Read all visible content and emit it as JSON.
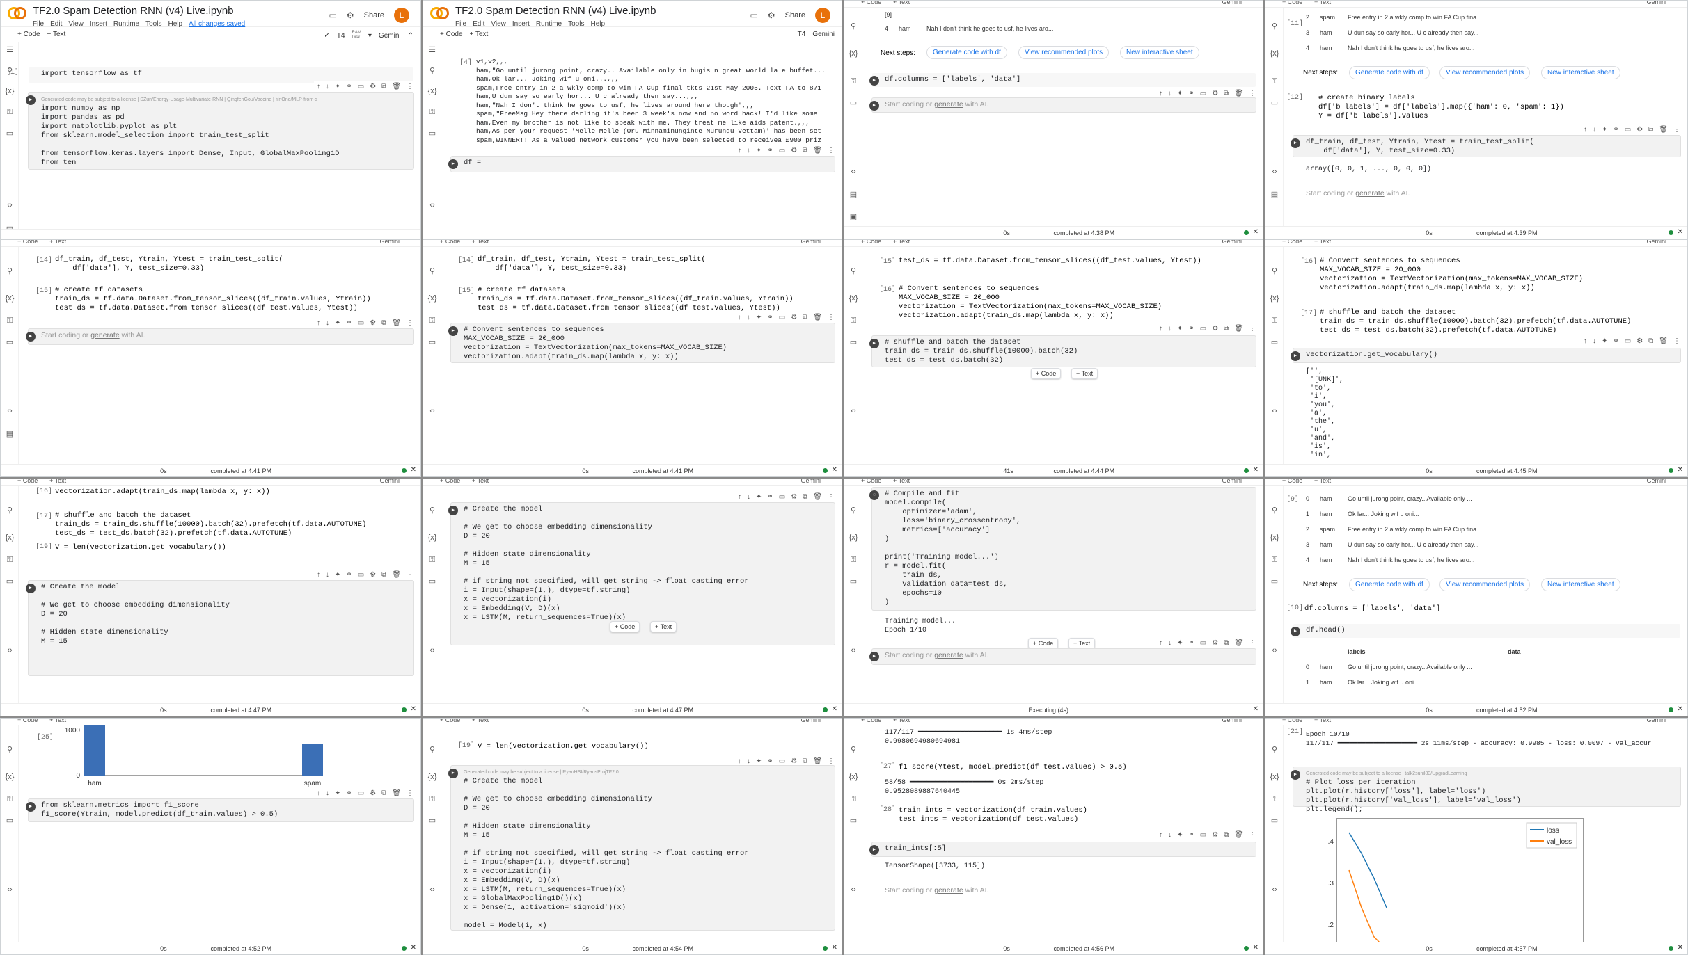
{
  "notebook": {
    "title": "TF2.0 Spam Detection RNN (v4) Live.ipynb",
    "menu": [
      "File",
      "Edit",
      "View",
      "Insert",
      "Runtime",
      "Tools",
      "Help"
    ],
    "saved": "All changes saved",
    "share": "Share",
    "avatar": "L",
    "add_code": "+ Code",
    "add_text": "+ Text",
    "runtime": "T4",
    "ram": "RAM",
    "disk": "Disk",
    "gemini": "Gemini",
    "placeholder_a": "Start coding or ",
    "placeholder_link": "generate",
    "placeholder_b": " with AI.",
    "generated_notice": "Generated code may be subject to a license | SZun/Energy-Usage-Multivariate-RNN | QingfenGou/Vaccine | YnOne/MLP-from-s",
    "notice2": "Generated code may be subject to a license | RyanHSI/RyansProjTF2.0",
    "notice3": "Generated code may be subject to a license | talk2sunil83/UpgradLearning",
    "next_steps": "Next steps:",
    "btn_gen": "Generate code with df",
    "btn_plots": "View recommended plots",
    "btn_sheet": "New interactive sheet"
  },
  "panels": [
    {
      "status_time": "",
      "status_text": ""
    },
    {
      "status_time": "",
      "status_text": ""
    },
    {
      "status_time": "0s",
      "status_text": "completed at 4:38 PM"
    },
    {
      "status_time": "0s",
      "status_text": "completed at 4:39 PM"
    },
    {
      "status_time": "0s",
      "status_text": "completed at 4:41 PM"
    },
    {
      "status_time": "0s",
      "status_text": "completed at 4:41 PM"
    },
    {
      "status_time": "41s",
      "status_text": "completed at 4:44 PM"
    },
    {
      "status_time": "0s",
      "status_text": "completed at 4:45 PM"
    },
    {
      "status_time": "0s",
      "status_text": "completed at 4:47 PM"
    },
    {
      "status_time": "0s",
      "status_text": "completed at 4:47 PM"
    },
    {
      "status_time": "",
      "status_text": "Executing (4s)"
    },
    {
      "status_time": "0s",
      "status_text": "completed at 4:52 PM"
    },
    {
      "status_time": "0s",
      "status_text": "completed at 4:52 PM"
    },
    {
      "status_time": "0s",
      "status_text": "completed at 4:54 PM"
    },
    {
      "status_time": "0s",
      "status_text": "completed at 4:56 PM"
    },
    {
      "status_time": "0s",
      "status_text": "completed at 4:57 PM"
    }
  ],
  "p1": {
    "exec1": "[1]",
    "code1": "import tensorflow as tf",
    "code2": "import numpy as np\nimport pandas as pd\nimport matplotlib.pyplot as plt\nfrom sklearn.model_selection import train_test_split\n\nfrom tensorflow.keras.layers import Dense, Input, GlobalMaxPooling1D\nfrom ten"
  },
  "p2": {
    "exec": "[4]",
    "out": "v1,v2,,,\nham,\"Go until jurong point, crazy.. Available only in bugis n great world la e buffet...\nham,Ok lar... Joking wif u oni...,,,\nspam,Free entry in 2 a wkly comp to win FA Cup final tkts 21st May 2005. Text FA to 871\nham,U dun say so early hor... U c already then say...,,,\nham,\"Nah I don't think he goes to usf, he lives around here though\",,,\nspam,\"FreeMsg Hey there darling it's been 3 week's now and no word back! I'd like some\nham,Even my brother is not like to speak with me. They treat me like aids patent.,,,\nham,As per your request 'Melle Melle (Oru Minnaminunginte Nurungu Vettam)' has been set\nspam,WINNER!! As a valued network customer you have been selected to receivea £900 priz",
    "code": "df = "
  },
  "p3": {
    "rows": [
      [
        "[9]",
        "",
        ""
      ],
      [
        "4",
        "ham",
        "Nah I don't think he goes to usf, he lives aro..."
      ]
    ],
    "code": "df.columns = ['labels', 'data']"
  },
  "p4": {
    "exec11": "[11]",
    "rows": [
      [
        "2",
        "spam",
        "Free entry in 2 a wkly comp to win FA Cup fina..."
      ],
      [
        "3",
        "ham",
        "U dun say so early hor... U c already then say..."
      ],
      [
        "4",
        "ham",
        "Nah I don't think he goes to usf, he lives aro..."
      ]
    ],
    "exec12": "[12]",
    "code12": "# create binary labels\ndf['b_labels'] = df['labels'].map({'ham': 0, 'spam': 1})\nY = df['b_labels'].values",
    "code13": "df_train, df_test, Ytrain, Ytest = train_test_split(\n    df['data'], Y, test_size=0.33)",
    "out13": "array([0, 0, 1, ..., 0, 0, 0])"
  },
  "p5": {
    "exec14": "[14]",
    "code14": "df_train, df_test, Ytrain, Ytest = train_test_split(\n    df['data'], Y, test_size=0.33)",
    "exec15": "[15]",
    "code15": "# create tf datasets\ntrain_ds = tf.data.Dataset.from_tensor_slices((df_train.values, Ytrain))\ntest_ds = tf.data.Dataset.from_tensor_slices((df_test.values, Ytest))"
  },
  "p6": {
    "code16": "# Convert sentences to sequences\nMAX_VOCAB_SIZE = 20_000\nvectorization = TextVectorization(max_tokens=MAX_VOCAB_SIZE)\nvectorization.adapt(train_ds.map(lambda x, y: x))"
  },
  "p7": {
    "exec15": "[15]",
    "code15": "test_ds = tf.data.Dataset.from_tensor_slices((df_test.values, Ytest))",
    "exec16": "[16]",
    "code17": "# shuffle and batch the dataset\ntrain_ds = train_ds.shuffle(10000).batch(32)\ntest_ds = test_ds.batch(32)"
  },
  "p8": {
    "exec16": "[16]",
    "exec17": "[17]",
    "code17": "# shuffle and batch the dataset\ntrain_ds = train_ds.shuffle(10000).batch(32).prefetch(tf.data.AUTOTUNE)\ntest_ds = test_ds.batch(32).prefetch(tf.data.AUTOTUNE)",
    "code18": "vectorization.get_vocabulary()",
    "out18": "['',\n '[UNK]',\n 'to',\n 'i',\n 'you',\n 'a',\n 'the',\n 'u',\n 'and',\n 'is',\n 'in',"
  },
  "p9": {
    "exec16": "[16]",
    "code16": "vectorization.adapt(train_ds.map(lambda x, y: x))",
    "exec17": "[17]",
    "exec19": "[19]",
    "code19": "V = len(vectorization.get_vocabulary())",
    "code20": "# Create the model\n\n# We get to choose embedding dimensionality\nD = 20\n\n# Hidden state dimensionality\nM = 15"
  },
  "p10": {
    "code": "# Create the model\n\n# We get to choose embedding dimensionality\nD = 20\n\n# Hidden state dimensionality\nM = 15\n\n# if string not specified, will get string -> float casting error\ni = Input(shape=(1,), dtype=tf.string)\nx = vectorization(i)\nx = Embedding(V, D)(x)\nx = LSTM(M, return_sequences=True)(x)"
  },
  "p11": {
    "code": "# Compile and fit\nmodel.compile(\n    optimizer='adam',\n    loss='binary_crossentropy',\n    metrics=['accuracy']\n)\n\nprint('Training model...')\nr = model.fit(\n    train_ds,\n    validation_data=test_ds,\n    epochs=10\n)",
    "out": "Training model...\nEpoch 1/10"
  },
  "p12": {
    "exec9": "[9]",
    "rows": [
      [
        "0",
        "ham",
        "Go until jurong point, crazy.. Available only ..."
      ],
      [
        "1",
        "ham",
        "Ok lar... Joking wif u oni..."
      ],
      [
        "2",
        "spam",
        "Free entry in 2 a wkly comp to win FA Cup fina..."
      ],
      [
        "3",
        "ham",
        "U dun say so early hor... U c already then say..."
      ],
      [
        "4",
        "ham",
        "Nah I don't think he goes to usf, he lives aro..."
      ]
    ],
    "exec10": "[10]",
    "code10": "df.columns = ['labels', 'data']",
    "code11": "df.head()",
    "h_labels": "labels",
    "h_data": "data",
    "rows2": [
      [
        "0",
        "ham",
        "Go until jurong point, crazy.. Available only ..."
      ],
      [
        "1",
        "ham",
        "Ok lar... Joking wif u oni..."
      ]
    ]
  },
  "p13": {
    "exec": "[25]",
    "ytick": "1000",
    "ytick0": "0",
    "cat1": "ham",
    "cat2": "spam",
    "code": "from sklearn.metrics import f1_score\nf1_score(Ytrain, model.predict(df_train.values) > 0.5)"
  },
  "chart_data": [
    {
      "type": "bar",
      "categories": [
        "ham",
        "spam"
      ],
      "values": [
        1200,
        750
      ],
      "ylim": [
        0,
        1200
      ]
    },
    {
      "type": "line",
      "x": [
        0,
        1,
        2,
        3
      ],
      "series": [
        {
          "name": "loss",
          "values": [
            0.42,
            0.37,
            0.31,
            0.24
          ]
        },
        {
          "name": "val_loss",
          "values": [
            0.33,
            0.24,
            0.17,
            0.14
          ]
        }
      ],
      "yticks": [
        "0.4",
        "0.3",
        "0.2"
      ],
      "legend": "top-right"
    }
  ],
  "p14": {
    "exec19": "[19]",
    "code19": "V = len(vectorization.get_vocabulary())",
    "code": "# Create the model\n\n# We get to choose embedding dimensionality\nD = 20\n\n# Hidden state dimensionality\nM = 15\n\n# if string not specified, will get string -> float casting error\ni = Input(shape=(1,), dtype=tf.string)\nx = vectorization(i)\nx = Embedding(V, D)(x)\nx = LSTM(M, return_sequences=True)(x)\nx = GlobalMaxPooling1D()(x)\nx = Dense(1, activation='sigmoid')(x)\n\nmodel = Model(i, x)"
  },
  "p15": {
    "out1": "117/117 ━━━━━━━━━━━━━━━━━━━━ 1s 4ms/step\n0.9980694980694981",
    "exec27": "[27]",
    "code27": "f1_score(Ytest, model.predict(df_test.values) > 0.5)",
    "out27": "58/58 ━━━━━━━━━━━━━━━━━━━━ 0s 2ms/step\n0.9528089887640445",
    "exec28": "[28]",
    "code28": "train_ints = vectorization(df_train.values)\ntest_ints = vectorization(df_test.values)",
    "code29": "train_ints[:5]",
    "out29": "TensorShape([3733, 115])"
  },
  "p16": {
    "exec": "[21]",
    "out": "Epoch 10/10\n117/117 ━━━━━━━━━━━━━━━━━━━━ 2s 11ms/step - accuracy: 0.9985 - loss: 0.0097 - val_accur",
    "code": "# Plot loss per iteration\nplt.plot(r.history['loss'], label='loss')\nplt.plot(r.history['val_loss'], label='val_loss')\nplt.legend();"
  }
}
